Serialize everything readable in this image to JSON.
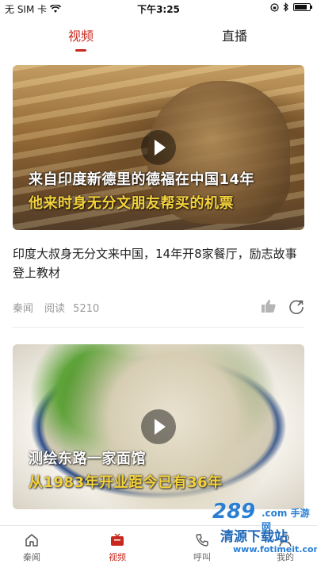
{
  "status_bar": {
    "carrier": "无 SIM 卡",
    "time": "下午3:25",
    "battery_level": 0.85
  },
  "top_tabs": [
    {
      "label": "视频",
      "active": true
    },
    {
      "label": "直播",
      "active": false
    }
  ],
  "feed": [
    {
      "overlay_line1": "来自印度新德里的德福在中国14年",
      "overlay_line2": "他来时身无分文朋友帮买的机票",
      "title": "印度大叔身无分文来中国，14年开8家餐厅，励志故事登上教材",
      "source": "秦闻",
      "read_label": "阅读",
      "read_count": "5210"
    },
    {
      "overlay_line1": "测绘东路一家面馆",
      "overlay_line2": "从1983年开业距今已有36年"
    }
  ],
  "bottom_nav": [
    {
      "label": "秦闻",
      "icon": "home-icon",
      "active": false
    },
    {
      "label": "视频",
      "icon": "tv-icon",
      "active": true
    },
    {
      "label": "呼叫",
      "icon": "call-icon",
      "active": false
    },
    {
      "label": "我的",
      "icon": "person-icon",
      "active": false
    }
  ],
  "watermark": {
    "brand": "289",
    "brand_suffix": ".com 手游网",
    "main": "清源下载站",
    "url": "www.fotimeit.com"
  },
  "colors": {
    "accent": "#c8281e",
    "overlay_highlight": "#f5d23c",
    "meta_gray": "#9a9a9a"
  }
}
